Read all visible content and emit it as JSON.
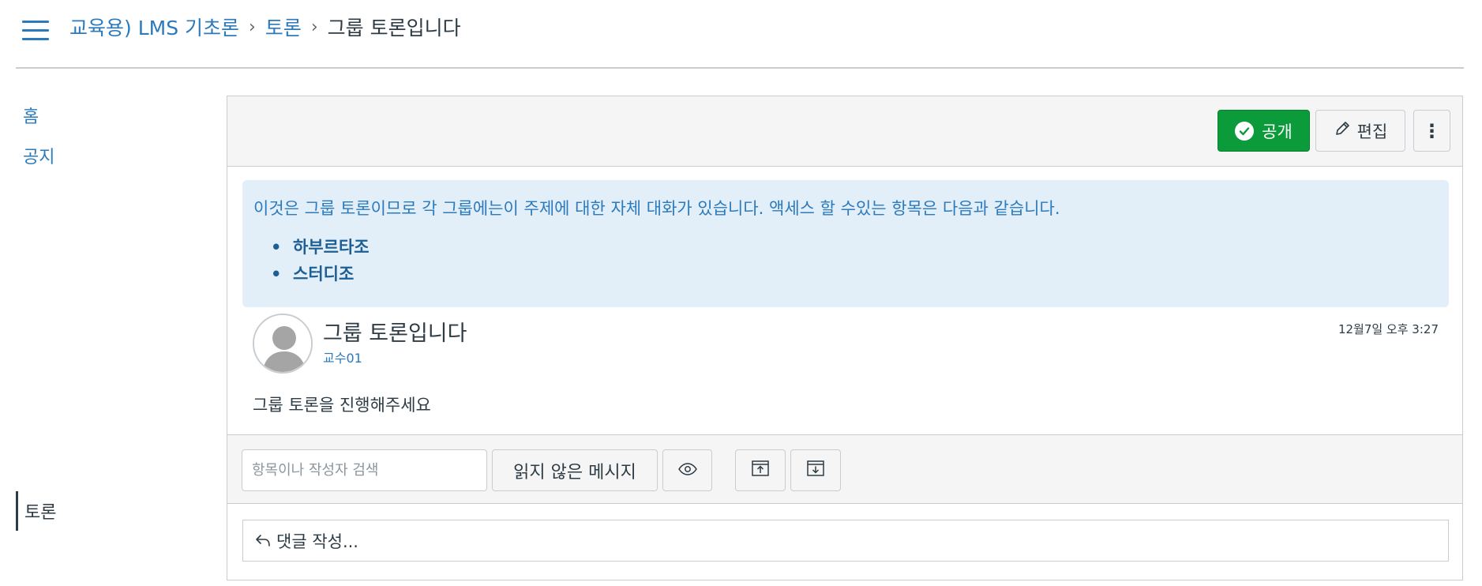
{
  "breadcrumb": {
    "course": "교육용) LMS 기초론",
    "section": "토론",
    "current": "그룹 토론입니다",
    "separator": "›"
  },
  "nav": {
    "items": [
      {
        "label": "홈"
      },
      {
        "label": "공지"
      }
    ],
    "active": "토론"
  },
  "toolbar": {
    "publish_label": "공개",
    "edit_label": "편집",
    "more_label": "⋮"
  },
  "info": {
    "text": "이것은 그룹 토론이므로 각 그룹에는이 주제에 대한 자체 대화가 있습니다. 액세스 할 수있는 항목은 다음과 같습니다.",
    "groups": [
      "하부르타조",
      "스터디조"
    ]
  },
  "post": {
    "title": "그룹 토론입니다",
    "author": "교수01",
    "date": "12월7일 오후 3:27",
    "body": "그룹 토론을 진행해주세요"
  },
  "filter": {
    "search_placeholder": "항목이나 작성자 검색",
    "unread_label": "읽지 않은 메시지"
  },
  "reply": {
    "label": "댓글 작성..."
  },
  "colors": {
    "link": "#2b7abc",
    "publish": "#0b9b3a",
    "info_bg": "#e2eef8"
  },
  "icons": [
    "hamburger-icon",
    "check-icon",
    "pencil-icon",
    "kebab-icon",
    "eye-icon",
    "collapse-icon",
    "expand-icon",
    "reply-arrow-icon",
    "avatar-icon"
  ]
}
